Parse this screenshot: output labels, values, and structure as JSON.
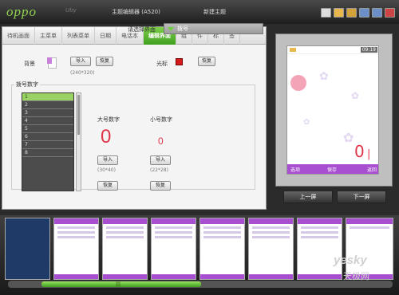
{
  "app": {
    "logo": "oppo",
    "logo_script": "Uby",
    "title": "主题编辑器 (A520)",
    "doc": "新建主题"
  },
  "tabs": [
    "待机画面",
    "主菜单",
    "列表菜单",
    "日期",
    "电话本",
    "编辑界面",
    "组",
    "件",
    "标",
    "签"
  ],
  "active_tab": 5,
  "selector": {
    "label": "请选择界面",
    "value": "拨号"
  },
  "background": {
    "label": "背景",
    "import": "导入",
    "restore": "恢复",
    "size": "(240*320)"
  },
  "cursor": {
    "label": "光标",
    "restore": "恢复",
    "color": "#d41a1a"
  },
  "numbers": {
    "legend": "拨号数字",
    "list": [
      "1",
      "2",
      "3",
      "4",
      "5",
      "6",
      "7",
      "8"
    ],
    "big": {
      "label": "大号数字",
      "sample": "0",
      "import": "导入",
      "size": "(30*40)",
      "restore": "恢复"
    },
    "small": {
      "label": "小号数字",
      "sample": "0",
      "import": "导入",
      "size": "(22*28)",
      "restore": "恢复"
    }
  },
  "phone": {
    "time": "09:19",
    "soft_left": "选项",
    "soft_mid": "保存",
    "soft_right": "返回",
    "digit": "0"
  },
  "nav": {
    "prev": "上一屏",
    "next": "下一屏"
  },
  "watermark": {
    "brand": "yesky",
    "brand_cn": "天极网"
  },
  "thumbs": 9,
  "colors": {
    "accent": "#7ed04a",
    "phone_bar": "#a84ed0",
    "digit": "#e0364a"
  }
}
